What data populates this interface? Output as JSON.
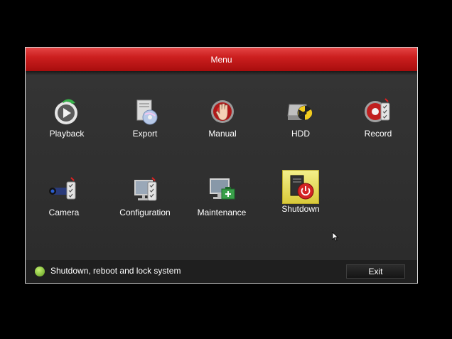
{
  "window": {
    "title": "Menu"
  },
  "menu": {
    "items": [
      {
        "label": "Playback",
        "icon": "playback-icon"
      },
      {
        "label": "Export",
        "icon": "export-icon"
      },
      {
        "label": "Manual",
        "icon": "manual-icon"
      },
      {
        "label": "HDD",
        "icon": "hdd-icon"
      },
      {
        "label": "Record",
        "icon": "record-icon"
      },
      {
        "label": "Camera",
        "icon": "camera-icon"
      },
      {
        "label": "Configuration",
        "icon": "configuration-icon"
      },
      {
        "label": "Maintenance",
        "icon": "maintenance-icon"
      },
      {
        "label": "Shutdown",
        "icon": "shutdown-icon",
        "selected": true
      }
    ]
  },
  "status": {
    "text": "Shutdown, reboot and lock system",
    "icon": "help-icon"
  },
  "buttons": {
    "exit": "Exit"
  },
  "colors": {
    "title_red": "#c81c1c",
    "selected_yellow": "#e9e06a",
    "status_green": "#7cc42a"
  }
}
